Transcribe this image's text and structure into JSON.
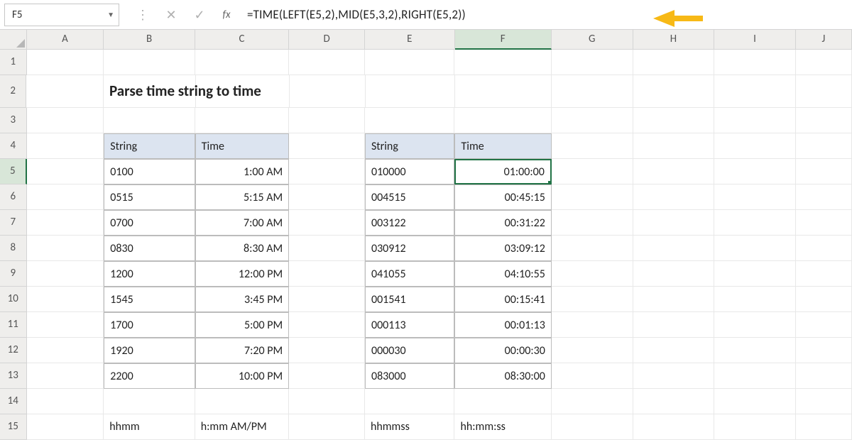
{
  "nameBox": "F5",
  "formula": "=TIME(LEFT(E5,2),MID(E5,3,2),RIGHT(E5,2))",
  "columns": [
    "A",
    "B",
    "C",
    "D",
    "E",
    "F",
    "G",
    "H",
    "I",
    "J"
  ],
  "activeCol": "F",
  "activeRow": 5,
  "title": "Parse time string to time",
  "table1": {
    "headers": {
      "string": "String",
      "time": "Time"
    },
    "rows": [
      {
        "s": "0100",
        "t": "1:00 AM"
      },
      {
        "s": "0515",
        "t": "5:15 AM"
      },
      {
        "s": "0700",
        "t": "7:00 AM"
      },
      {
        "s": "0830",
        "t": "8:30 AM"
      },
      {
        "s": "1200",
        "t": "12:00 PM"
      },
      {
        "s": "1545",
        "t": "3:45 PM"
      },
      {
        "s": "1700",
        "t": "5:00 PM"
      },
      {
        "s": "1920",
        "t": "7:20 PM"
      },
      {
        "s": "2200",
        "t": "10:00 PM"
      }
    ],
    "footer": {
      "s": "hhmm",
      "t": "h:mm AM/PM"
    }
  },
  "table2": {
    "headers": {
      "string": "String",
      "time": "Time"
    },
    "rows": [
      {
        "s": "010000",
        "t": "01:00:00"
      },
      {
        "s": "004515",
        "t": "00:45:15"
      },
      {
        "s": "003122",
        "t": "00:31:22"
      },
      {
        "s": "030912",
        "t": "03:09:12"
      },
      {
        "s": "041055",
        "t": "04:10:55"
      },
      {
        "s": "001541",
        "t": "00:15:41"
      },
      {
        "s": "000113",
        "t": "00:01:13"
      },
      {
        "s": "000030",
        "t": "00:00:30"
      },
      {
        "s": "083000",
        "t": "08:30:00"
      }
    ],
    "footer": {
      "s": "hhmmss",
      "t": "hh:mm:ss"
    }
  },
  "rowNumbers": [
    1,
    2,
    3,
    4,
    5,
    6,
    7,
    8,
    9,
    10,
    11,
    12,
    13,
    14,
    15
  ]
}
